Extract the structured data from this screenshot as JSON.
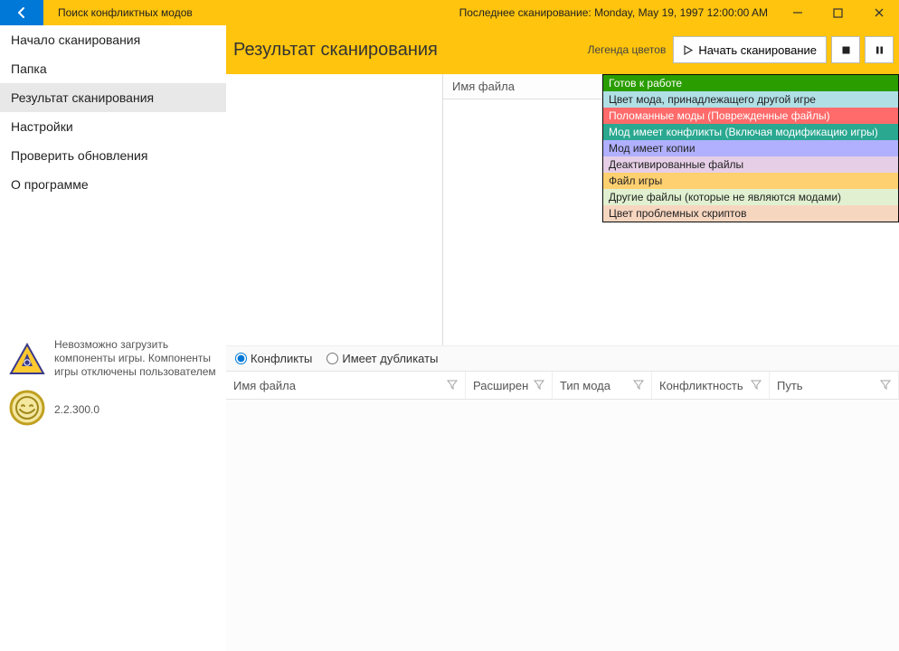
{
  "titlebar": {
    "app_title": "Поиск конфликтных модов",
    "last_scan": "Последнее сканирование: Monday, May 19, 1997 12:00:00 AM"
  },
  "sidebar": {
    "items": [
      {
        "label": "Начало сканирования"
      },
      {
        "label": "Папка"
      },
      {
        "label": "Результат сканирования"
      },
      {
        "label": "Настройки"
      },
      {
        "label": "Проверить обновления"
      },
      {
        "label": "О программе"
      }
    ],
    "status_text": "Невозможно загрузить компоненты игры. Компоненты игры отключены пользователем",
    "version": "2.2.300.0"
  },
  "header": {
    "page_title": "Результат сканирования",
    "legend_label": "Легенда цветов",
    "start_scan": "Начать сканирование"
  },
  "filelist": {
    "column": "Имя файла"
  },
  "legend": [
    {
      "text": "Готов к работе",
      "bg": "#2a9d00",
      "dark": false
    },
    {
      "text": "Цвет мода, принадлежащего другой игре",
      "bg": "#b0e0e6",
      "dark": true
    },
    {
      "text": "Поломанные моды (Поврежденные файлы)",
      "bg": "#ff6a6a",
      "dark": false
    },
    {
      "text": "Мод имеет конфликты (Включая модификацию игры)",
      "bg": "#2aa890",
      "dark": false
    },
    {
      "text": "Мод имеет копии",
      "bg": "#b0b0ff",
      "dark": true
    },
    {
      "text": "Деактивированные файлы",
      "bg": "#e6cfe6",
      "dark": true
    },
    {
      "text": "Файл игры",
      "bg": "#ffd070",
      "dark": true
    },
    {
      "text": "Другие файлы (которые не являются модами)",
      "bg": "#e0f0d0",
      "dark": true
    },
    {
      "text": "Цвет проблемных скриптов",
      "bg": "#f7d6c0",
      "dark": true
    }
  ],
  "radios": {
    "conflicts": "Конфликты",
    "duplicates": "Имеет дубликаты"
  },
  "table": {
    "cols": {
      "file": "Имя файла",
      "ext": "Расширен",
      "type": "Тип мода",
      "conflict": "Конфликтность",
      "path": "Путь"
    }
  }
}
